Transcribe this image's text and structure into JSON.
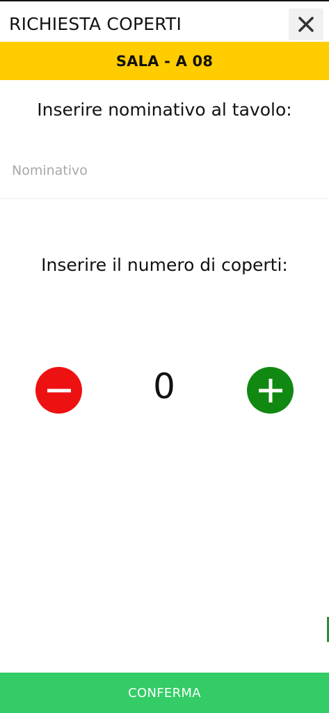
{
  "header": {
    "title": "RICHIESTA COPERTI",
    "close_icon": "close-icon"
  },
  "banner": {
    "text": "SALA - A 08",
    "color": "#ffcc00"
  },
  "name_section": {
    "label": "Inserire nominativo al tavolo:",
    "input_value": "",
    "placeholder": "Nominativo"
  },
  "count_section": {
    "label": "Inserire il numero di coperti:",
    "value": "0",
    "minus_icon": "minus-icon",
    "minus_color": "#ee1111",
    "plus_icon": "plus-icon",
    "plus_color": "#118811"
  },
  "footer": {
    "confirm_label": "CONFERMA",
    "confirm_color": "#33cc66"
  }
}
